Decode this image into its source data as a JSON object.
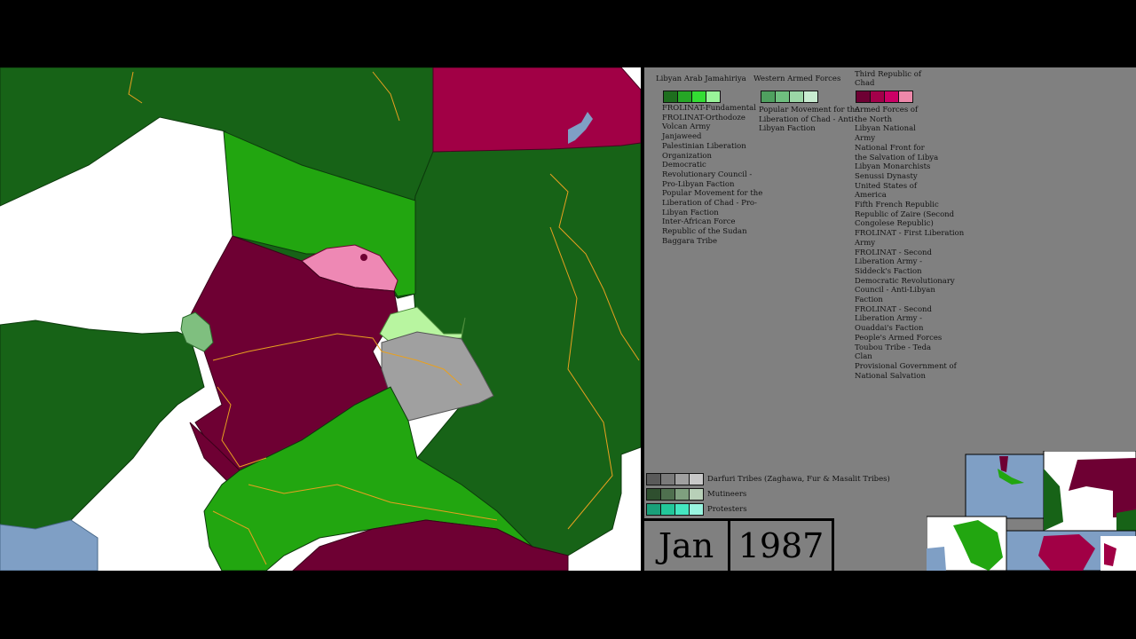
{
  "date": {
    "month": "Jan",
    "year": "1987"
  },
  "legend": {
    "col1": {
      "title": "Libyan Arab Jamahiriya",
      "colors": [
        "#1e6e1e",
        "#26a626",
        "#33dd33",
        "#99f599"
      ],
      "items": [
        "FROLINAT-Fundamental",
        "FROLINAT-Orthodoze",
        "Volcan Army",
        "Janjaweed",
        "Palestinian Liberation",
        "Organization",
        "Democratic",
        "Revolutionary Council -",
        "Pro-Libyan Faction",
        "Popular Movement for the",
        "Liberation of Chad - Pro-",
        "Libyan Faction",
        "Inter-African Force",
        "Republic of the Sudan",
        "Baggara Tribe"
      ]
    },
    "col2": {
      "title": "Western Armed Forces",
      "colors": [
        "#4fa05f",
        "#6fbf7f",
        "#9bd6a6",
        "#c8ecd0"
      ],
      "items": [
        "Popular Movement for the",
        "Liberation of Chad - Anti-",
        "Libyan Faction"
      ]
    },
    "col3": {
      "title": "Third Republic of Chad",
      "colors": [
        "#6e0033",
        "#a3004a",
        "#cc0066",
        "#ee88aa"
      ],
      "items": [
        "Armed Forces of",
        "the North",
        "Libyan National",
        "Army",
        "National Front for",
        "the Salvation of Libya",
        "Libyan Monarchists",
        "Senussi Dynasty",
        "United States of",
        "America",
        "Fifth French Republic",
        "Republic of Zaire (Second",
        "Congolese Republic)",
        "FROLINAT - First Liberation",
        "Army",
        "FROLINAT - Second",
        "Liberation Army -",
        "Siddeck's Faction",
        "Democratic Revolutionary",
        "Council - Anti-Libyan",
        "Faction",
        "FROLINAT - Second",
        "Liberation Army -",
        "Ouaddai's Faction",
        "People's Armed Forces",
        "Toubou Tribe - Teda",
        "Clan",
        "Provisional Government of",
        "National Salvation"
      ]
    },
    "bottom": [
      {
        "label": "Darfuri Tribes (Zaghawa, Fur & Masalit Tribes)",
        "colors": [
          "#5a5a5a",
          "#7a7a7a",
          "#a0a0a0",
          "#c8c8c8"
        ]
      },
      {
        "label": "Mutineers",
        "colors": [
          "#2f4f2f",
          "#4f704f",
          "#7fa07f",
          "#b8d0b8"
        ]
      },
      {
        "label": "Protesters",
        "colors": [
          "#1aa07a",
          "#22c79a",
          "#44e6c0",
          "#99f5e0"
        ]
      }
    ]
  },
  "colors": {
    "dark_green": "#176317",
    "bright_green": "#22a610",
    "maroon": "#6e0033",
    "crimson": "#a10045",
    "pink": "#ee88b4",
    "gray": "#a0a0a0",
    "light_green": "#b8f5a0",
    "white": "#ffffff",
    "sea": "#7f9fc5",
    "road": "#e8a020",
    "legend_bg": "#808080"
  }
}
